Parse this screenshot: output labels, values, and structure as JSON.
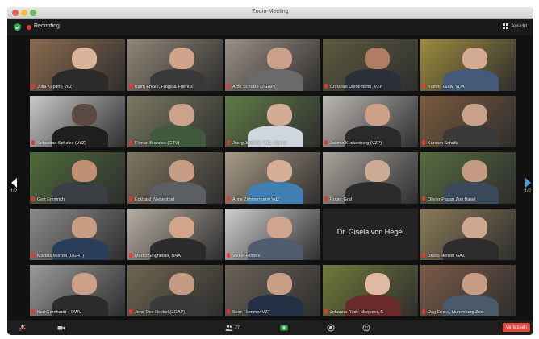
{
  "window": {
    "title": "Zoom-Meeting"
  },
  "topbar": {
    "recording_label": "Recording",
    "view_label": "Ansicht"
  },
  "pagination": {
    "left": "1/2",
    "right": "1/2"
  },
  "participants": [
    {
      "name": "Julia Köpler | VdZ",
      "bg": "#8a6a4e",
      "skin": "#d9b49a",
      "shirt": "#2b2b2b",
      "muted": true
    },
    {
      "name": "Björn Encke, Frogs & Friends",
      "bg": "#8f8676",
      "skin": "#d0a48a",
      "shirt": "#3a3a3a",
      "muted": true
    },
    {
      "name": "Arne Schulze (ZGAP)",
      "bg": "#9a8f84",
      "skin": "#caa08a",
      "shirt": "#6a6a6a",
      "muted": true
    },
    {
      "name": "Christian Dienemann, VZP",
      "bg": "#5c5a3e",
      "skin": "#b07c63",
      "shirt": "#2a2f3a",
      "muted": true
    },
    {
      "name": "Kathrin Glaw, VDA",
      "bg": "#9b8a3c",
      "skin": "#d3aa92",
      "shirt": "#445a78",
      "muted": true
    },
    {
      "name": "Sebastian Scholze (VdZ)",
      "bg": "#c9c9c9",
      "skin": "#5a4a42",
      "shirt": "#1f1f1f",
      "muted": true
    },
    {
      "name": "Florian Brandes (GTV)",
      "bg": "#7c7a62",
      "skin": "#caa38a",
      "shirt": "#3f5a3c",
      "muted": true
    },
    {
      "name": "Joerg Junhold, VdZ, Zoo Le",
      "bg": "#5f7a46",
      "skin": "#d4ab95",
      "shirt": "#cfd6de",
      "muted": true,
      "active": true
    },
    {
      "name": "Jasmin Kuckenberg (VZP)",
      "bg": "#bcb8b4",
      "skin": "#cfa088",
      "shirt": "#2a2a2a",
      "muted": true
    },
    {
      "name": "Karsten Schultz",
      "bg": "#7a5a3e",
      "skin": "#c9a08a",
      "shirt": "#3a3a3a",
      "muted": true
    },
    {
      "name": "Gert Emmrich",
      "bg": "#4e6b3a",
      "skin": "#c18f74",
      "shirt": "#3b3f45",
      "muted": true
    },
    {
      "name": "Eckhard Wiesenthal",
      "bg": "#7f765f",
      "skin": "#c89d86",
      "shirt": "#5b5f64",
      "muted": true
    },
    {
      "name": "Anne Zimmermann VdZ",
      "bg": "#a89a86",
      "skin": "#d6ad95",
      "shirt": "#3f7fb3",
      "muted": true
    },
    {
      "name": "Roger Graf",
      "bg": "#a7a29b",
      "skin": "#ccab96",
      "shirt": "#2b2b2b",
      "muted": true
    },
    {
      "name": "Olivier Pagan Zoo Basel",
      "bg": "#556b40",
      "skin": "#c59a82",
      "shirt": "#3b4a5a",
      "muted": true
    },
    {
      "name": "Markus Monzel (DGHT)",
      "bg": "#8c8c8c",
      "skin": "#c99c84",
      "shirt": "#2a3e5a",
      "muted": true
    },
    {
      "name": "Martin Singheiser, BNA",
      "bg": "#b6aea3",
      "skin": "#d2a48a",
      "shirt": "#2b2b2b",
      "muted": true
    },
    {
      "name": "Volker Homes",
      "bg": "#cfcfcf",
      "skin": "#d1a58d",
      "shirt": "#4f5e6e",
      "muted": true
    },
    {
      "name": "Dr. Gisela von Hegel",
      "textonly": true
    },
    {
      "name": "Bruno Hensel GAZ",
      "bg": "#8a7a58",
      "skin": "#cfa78f",
      "shirt": "#2c2c2c",
      "muted": true
    },
    {
      "name": "Karl Gornhardt – DWV",
      "bg": "#9a9a9a",
      "skin": "#cfa088",
      "shirt": "#2b2b2b",
      "muted": true
    },
    {
      "name": "Jens-Ove Heckel (ZGAP)",
      "bg": "#6e6650",
      "skin": "#c49a82",
      "shirt": "#3a3a3a",
      "muted": true
    },
    {
      "name": "Sven Hammer VZT",
      "bg": "#6b6259",
      "skin": "#c99e86",
      "shirt": "#243044",
      "muted": true
    },
    {
      "name": "Johanna Rode-Margono, S",
      "bg": "#6f7a3a",
      "skin": "#e0b9a2",
      "shirt": "#6a2a2a",
      "muted": true
    },
    {
      "name": "Dag Encke, Nuremberg Zoo",
      "bg": "#7a5a48",
      "skin": "#c99c84",
      "shirt": "#4a5a6a",
      "muted": true
    }
  ],
  "toolbar": {
    "participants_count": "27",
    "leave_label": "Verlassen"
  }
}
